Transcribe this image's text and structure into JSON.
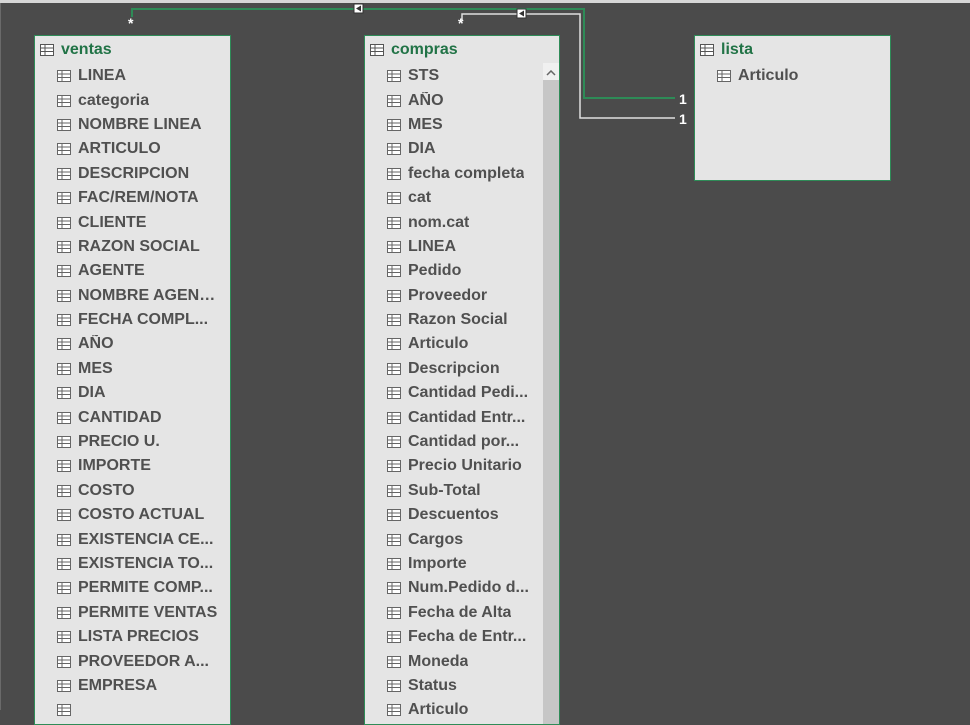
{
  "colors": {
    "canvas": "#4b4b4b",
    "table_bg": "#e5e5e5",
    "table_border": "#2e8b57",
    "title": "#217346",
    "field_text": "#505050",
    "active_relationship": "#2e8b57",
    "inactive_relationship": "#e0e0e0"
  },
  "tables": {
    "ventas": {
      "title": "ventas",
      "icon": "table-icon",
      "fields": [
        "LINEA",
        "categoria",
        "NOMBRE LINEA",
        "ARTICULO",
        "DESCRIPCION",
        "FAC/REM/NOTA",
        "CLIENTE",
        "RAZON SOCIAL",
        "AGENTE",
        "NOMBRE AGENTE",
        "FECHA COMPL...",
        "AÑO",
        "MES",
        "DIA",
        "CANTIDAD",
        "PRECIO U.",
        "IMPORTE",
        "COSTO",
        "COSTO ACTUAL",
        "EXISTENCIA CE...",
        "EXISTENCIA TO...",
        "PERMITE COMP...",
        "PERMITE VENTAS",
        "LISTA PRECIOS",
        "PROVEEDOR A...",
        "EMPRESA",
        ""
      ]
    },
    "compras": {
      "title": "compras",
      "icon": "table-icon",
      "fields": [
        "STS",
        "AÑO",
        "MES",
        "DIA",
        "fecha completa",
        "cat",
        "nom.cat",
        "LINEA",
        "Pedido",
        "Proveedor",
        "Razon Social",
        "Articulo",
        "Descripcion",
        "Cantidad Pedi...",
        "Cantidad Entr...",
        "Cantidad por...",
        "Precio Unitario",
        "Sub-Total",
        "Descuentos",
        "Cargos",
        "Importe",
        "Num.Pedido d...",
        "Fecha de Alta",
        "Fecha de Entr...",
        "Moneda",
        "Status",
        "Articulo"
      ]
    },
    "lista": {
      "title": "lista",
      "icon": "table-icon",
      "fields": [
        "Articulo"
      ]
    }
  },
  "relationships": [
    {
      "from": "ventas",
      "to": "lista",
      "from_cardinality": "*",
      "to_cardinality": "1",
      "active": true
    },
    {
      "from": "compras",
      "to": "lista",
      "from_cardinality": "*",
      "to_cardinality": "1",
      "active": false
    }
  ]
}
